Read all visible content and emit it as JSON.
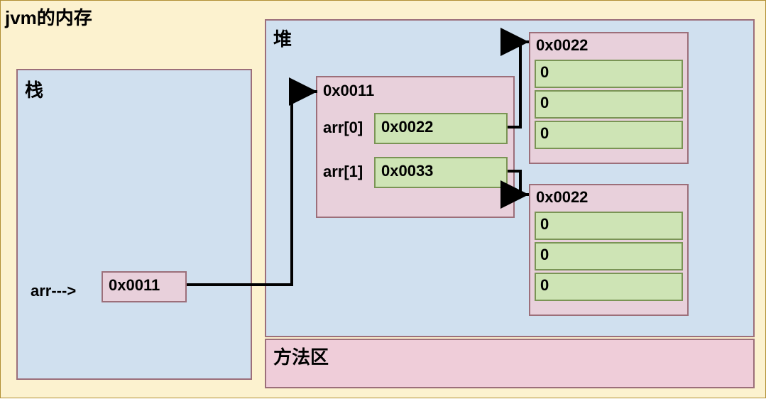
{
  "title": "jvm的内存",
  "stack": {
    "label": "栈",
    "var_label": "arr--->",
    "var_value": "0x0011"
  },
  "heap": {
    "label": "堆",
    "arr_object": {
      "address": "0x0011",
      "slots": [
        {
          "label": "arr[0]",
          "value": "0x0022"
        },
        {
          "label": "arr[1]",
          "value": "0x0033"
        }
      ]
    },
    "child_arrays": [
      {
        "address": "0x0022",
        "cells": [
          "0",
          "0",
          "0"
        ]
      },
      {
        "address": "0x0022",
        "cells": [
          "0",
          "0",
          "0"
        ]
      }
    ]
  },
  "method_area": {
    "label": "方法区"
  }
}
